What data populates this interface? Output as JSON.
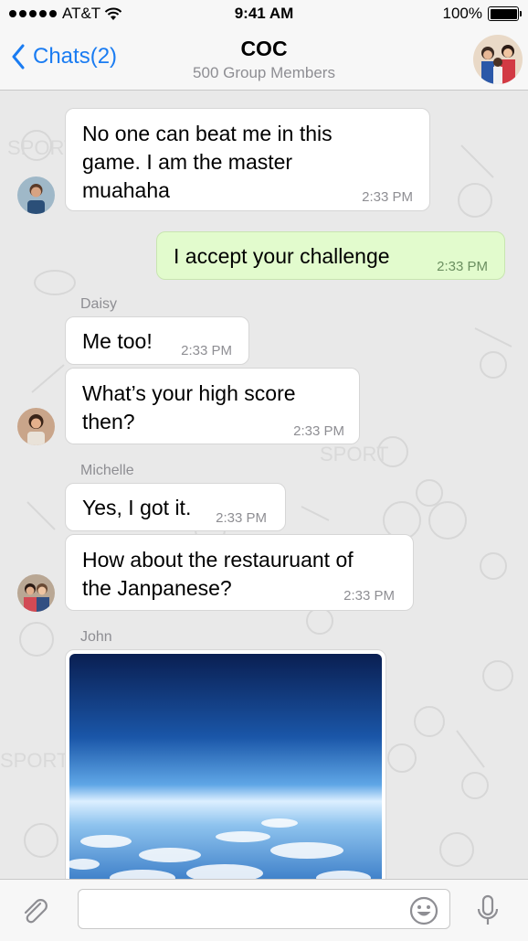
{
  "status_bar": {
    "carrier": "AT&T",
    "time": "9:41 AM",
    "battery": "100%"
  },
  "nav": {
    "back_label": "Chats(2)",
    "title": "COC",
    "subtitle": "500 Group Members"
  },
  "messages": [
    {
      "direction": "in",
      "sender": "",
      "lines": [
        "No one can beat me in this",
        "game. I am the master",
        "muahaha"
      ],
      "time": "2:33 PM"
    },
    {
      "direction": "out",
      "sender": "",
      "lines": [
        "I accept your challenge"
      ],
      "time": "2:33 PM"
    },
    {
      "direction": "in",
      "sender": "Daisy",
      "lines": [
        "Me too!"
      ],
      "time": "2:33 PM"
    },
    {
      "direction": "in",
      "sender": "",
      "lines": [
        "What’s your high score",
        "then?"
      ],
      "time": "2:33 PM"
    },
    {
      "direction": "in",
      "sender": "Michelle",
      "lines": [
        "Yes, I got it."
      ],
      "time": "2:33 PM"
    },
    {
      "direction": "in",
      "sender": "",
      "lines": [
        "How about the restauruant of",
        "the Janpanese?"
      ],
      "time": "2:33 PM"
    },
    {
      "direction": "in",
      "sender": "John",
      "type": "photo",
      "description": "earth-from-space"
    }
  ],
  "input": {
    "placeholder": "",
    "value": ""
  },
  "colors": {
    "accent": "#1a7cf2",
    "outgoing_bubble": "#e2fbcd",
    "incoming_bubble": "#ffffff",
    "chat_background": "#e9e9e9"
  },
  "icons": {
    "attach": "paperclip-icon",
    "emoji": "smiley-icon",
    "mic": "microphone-icon",
    "back": "chevron-left-icon",
    "wifi": "wifi-icon",
    "battery": "battery-icon"
  }
}
